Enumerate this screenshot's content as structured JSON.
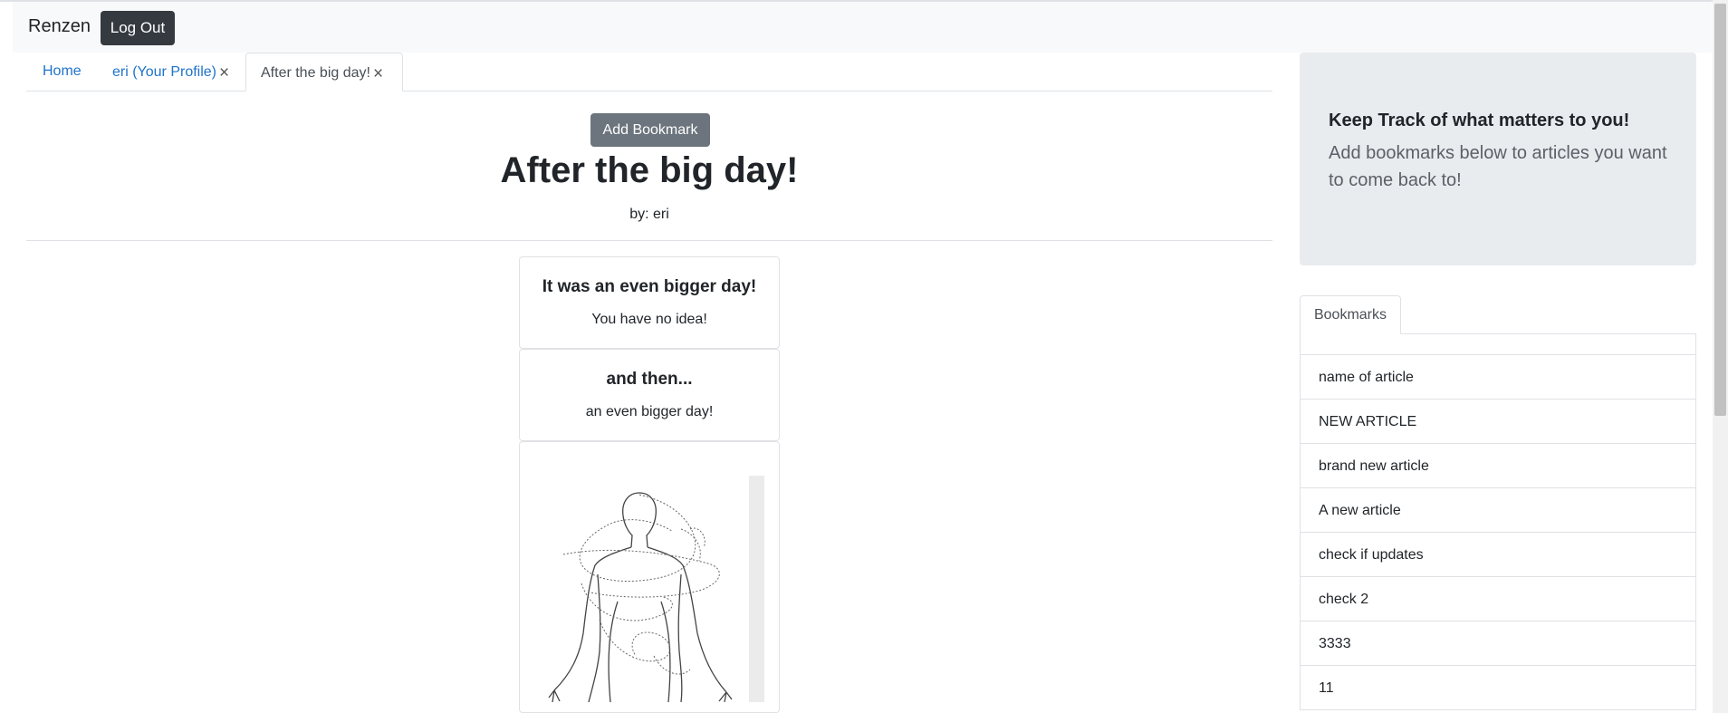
{
  "navbar": {
    "brand": "Renzen",
    "logout_label": "Log Out"
  },
  "tabs": [
    {
      "label": "Home"
    },
    {
      "label": "eri (Your Profile)",
      "close": "×"
    },
    {
      "label": "After the big day!",
      "close": "×",
      "active": true
    }
  ],
  "article": {
    "add_bookmark_label": "Add Bookmark",
    "title": "After the big day!",
    "byline": "by: eri",
    "cards": [
      {
        "title": "It was an even bigger day!",
        "text": "You have no idea!"
      },
      {
        "title": "and then...",
        "text": "an even bigger day!"
      }
    ],
    "image_icon": "figure-sketch"
  },
  "sidebar": {
    "jumbotron": {
      "heading": "Keep Track of what matters to you!",
      "text": "Add bookmarks below to articles you want to come back to!"
    },
    "bookmarks_tab": "Bookmarks",
    "bookmarks": [
      "name of article",
      "NEW ARTICLE",
      "brand new article",
      "A new article",
      "check if updates",
      "check 2",
      "3333",
      "11"
    ]
  },
  "colors": {
    "navbar_bg": "#f8f9fa",
    "dark_button": "#343a40",
    "secondary_button": "#6c757d",
    "link": "#1f73c9",
    "jumbotron_bg": "#e9ecef"
  }
}
